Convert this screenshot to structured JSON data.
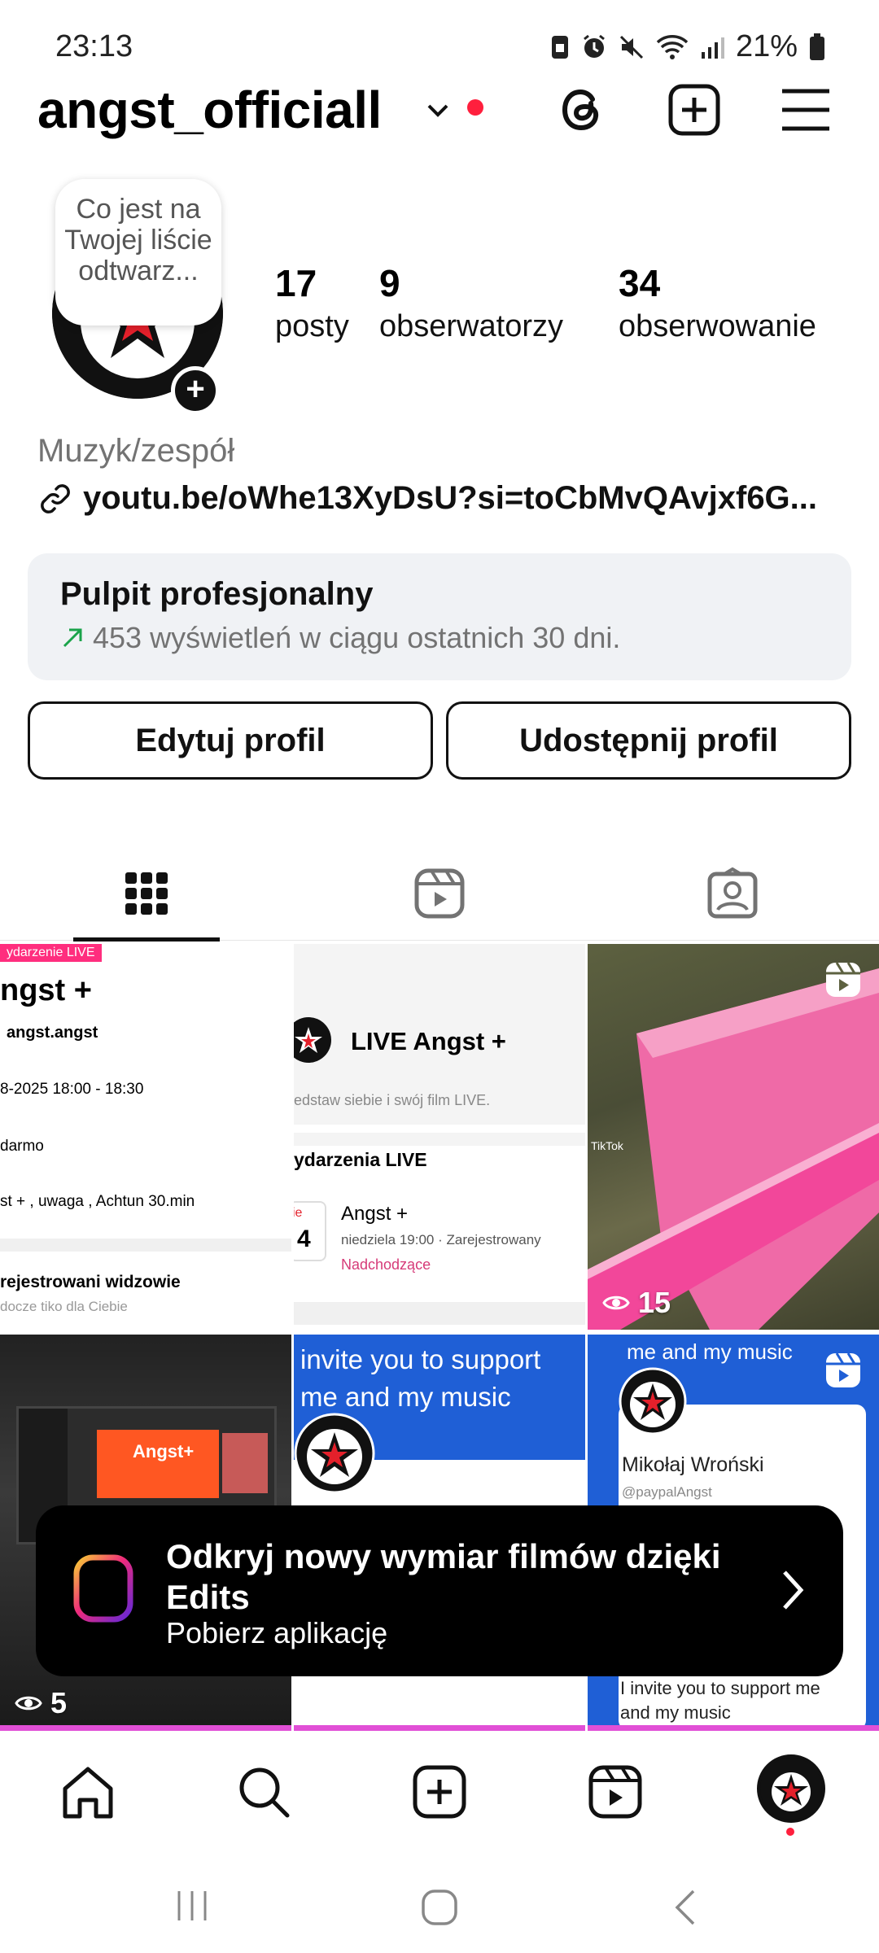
{
  "status_bar": {
    "time": "23:13",
    "battery": "21%",
    "icons": [
      "sim-card-icon",
      "alarm-icon",
      "mute-icon",
      "wifi-icon",
      "signal-icon",
      "battery-icon"
    ]
  },
  "header": {
    "username": "angst_officiall",
    "icons": [
      "chevron-down-icon",
      "threads-icon",
      "create-post-icon",
      "menu-icon"
    ],
    "notification_dot_color": "#ff1f3d"
  },
  "profile": {
    "note": "Co jest na Twojej liście odtwarz...",
    "stats": [
      {
        "value": "17",
        "label": "posty"
      },
      {
        "value": "9",
        "label": "obserwatorzy"
      },
      {
        "value": "34",
        "label": "obserwowanie"
      }
    ],
    "category": "Muzyk/zespół",
    "link": "youtu.be/oWhe13XyDsU?si=toCbMvQAvjxf6G..."
  },
  "dashboard": {
    "title": "Pulpit profesjonalny",
    "subtitle": "453 wyświetleń w ciągu ostatnich 30 dni."
  },
  "buttons": {
    "edit": "Edytuj profil",
    "share": "Udostępnij profil"
  },
  "tabs": [
    "grid-icon",
    "reels-icon",
    "tagged-icon"
  ],
  "posts": [
    {
      "badge": "ydarzenie LIVE",
      "title": "ngst +",
      "handle": "angst.angst",
      "date": "8-2025 18:00 - 18:30",
      "price": "darmo",
      "tags": "st + ,  uwaga , Achtun  30.min",
      "footer": "rejestrowani widzowie",
      "footer_sub": "docze tiko dla Ciebie"
    },
    {
      "title": "LIVE Angst +",
      "subtitle": "edstaw siebie i swój film LIVE.",
      "section": "ydarzenia LIVE",
      "day": "4",
      "day_prefix": "ie",
      "event": "Angst +",
      "event_time": "niedziela 19:00 · Zarejestrowany",
      "event_status": "Nadchodzące"
    },
    {
      "views": "15",
      "watermark": "TikTok"
    },
    {
      "views": "5",
      "screen_title": "Angst+"
    },
    {
      "text": "invite you to support me and my music"
    },
    {
      "top_text": "me and my music",
      "name": "Mikołaj Wroński",
      "handle": "@paypalAngst",
      "bottom_text": "I invite you to support me and my music"
    }
  ],
  "banner": {
    "title": "Odkryj nowy wymiar filmów dzięki Edits",
    "subtitle": "Pobierz aplikację"
  },
  "bottom_nav": [
    "home-icon",
    "search-icon",
    "create-icon",
    "reels-icon",
    "profile-avatar"
  ]
}
